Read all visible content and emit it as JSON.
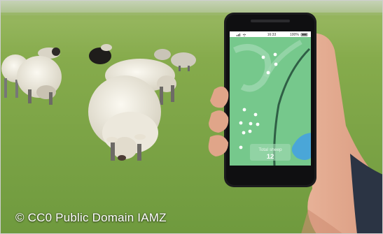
{
  "image": {
    "credit": "© CC0 Public Domain IAMZ"
  },
  "phone": {
    "status_time": "16:33",
    "status_battery": "100%",
    "map": {
      "counter_label": "Total sheep",
      "counter_value": "12"
    }
  },
  "colors": {
    "grass": "#7fa64a",
    "map_green": "#76c88c",
    "map_water": "#4aa6d8",
    "sheep_wool": "#efece2"
  },
  "icons": [
    "wifi-icon",
    "signal-icon",
    "battery-icon",
    "map-marker-icon"
  ]
}
